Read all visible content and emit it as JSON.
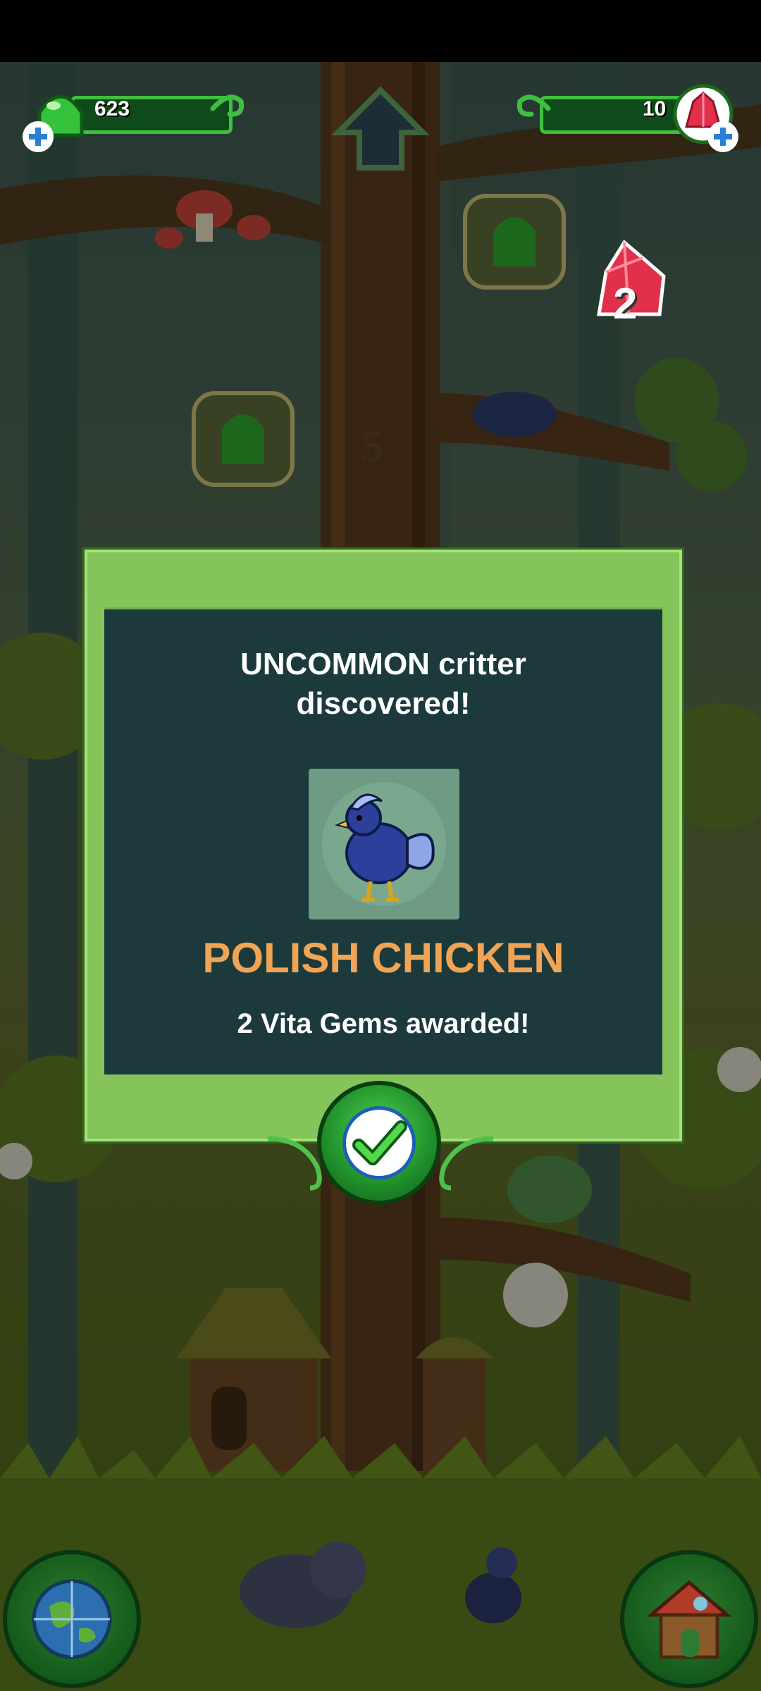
{
  "hud": {
    "gel_count": "623",
    "gem_count": "10"
  },
  "floating_reward": {
    "amount": "2"
  },
  "trunk_marker": "5",
  "dialog": {
    "headline_line1": "UNCOMMON critter",
    "headline_line2": "discovered!",
    "critter_name": "POLISH CHICKEN",
    "reward_text": "2 Vita Gems awarded!"
  },
  "colors": {
    "gel_green": "#3fbf3f",
    "gem_red": "#e0304a",
    "dialog_green": "#84c45a",
    "dialog_panel": "#1c3a3c",
    "critter_name": "#f2a455"
  },
  "icons": {
    "gel": "green-gel-icon",
    "gem": "red-crystal-icon",
    "confirm": "check-icon",
    "world": "globe-icon",
    "home": "treehouse-icon"
  }
}
